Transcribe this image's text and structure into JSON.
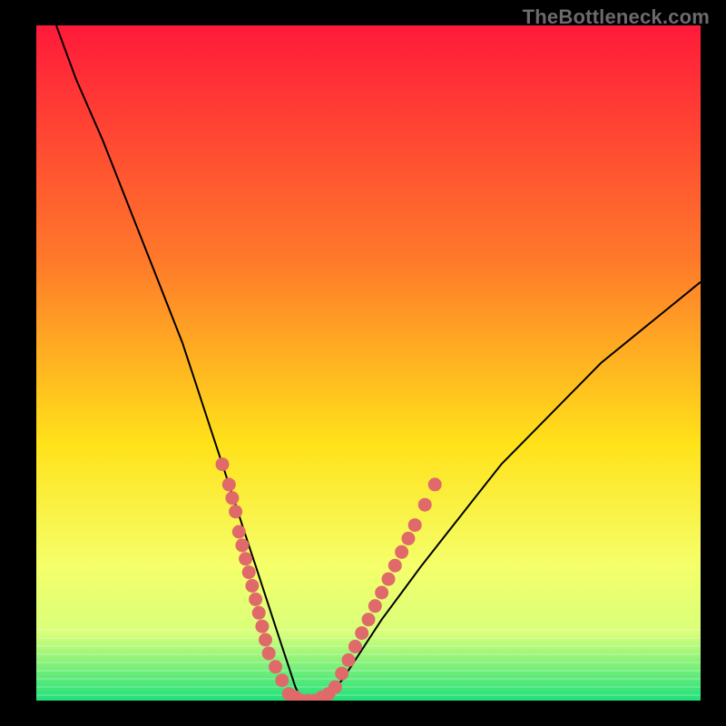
{
  "watermark": "TheBottleneck.com",
  "colors": {
    "frame": "#000000",
    "gradient_top": "#ff1a3a",
    "gradient_mid1": "#ff7a2a",
    "gradient_mid2": "#ffe21a",
    "gradient_low": "#f5ff6a",
    "gradient_band": "#d8ff7a",
    "gradient_bottom": "#1fe07a",
    "curve": "#000000",
    "dots": "#e06a6a"
  },
  "chart_data": {
    "type": "line",
    "title": "",
    "xlabel": "",
    "ylabel": "",
    "xlim": [
      0,
      100
    ],
    "ylim": [
      0,
      100
    ],
    "grid": false,
    "legend": false,
    "series": [
      {
        "name": "bottleneck-curve",
        "comment": "V-shaped bottleneck curve; y is approximate percentage bottleneck read from vertical position (0 = bottom/green, 100 = top/red).",
        "x": [
          3,
          6,
          10,
          14,
          18,
          22,
          24,
          26,
          28,
          30,
          31,
          32,
          33,
          34,
          35,
          36,
          37,
          38,
          39,
          40,
          41,
          42,
          43,
          44,
          46,
          48,
          50,
          52,
          55,
          58,
          62,
          66,
          70,
          75,
          80,
          85,
          90,
          95,
          100
        ],
        "y": [
          100,
          92,
          83,
          73,
          63,
          53,
          47,
          41,
          35,
          29,
          26,
          23,
          20,
          17,
          14,
          11,
          8,
          5,
          2,
          0,
          0,
          0,
          0,
          1,
          3,
          6,
          9,
          12,
          16,
          20,
          25,
          30,
          35,
          40,
          45,
          50,
          54,
          58,
          62
        ]
      }
    ],
    "annotations": {
      "valley_floor_x_range": [
        39,
        44
      ],
      "valley_floor_y": 0
    },
    "dot_clusters": {
      "comment": "Pink data markers clustered on both arms near the valley; y estimated relative to ylim.",
      "left_arm": [
        {
          "x": 28,
          "y": 35
        },
        {
          "x": 29,
          "y": 32
        },
        {
          "x": 29.5,
          "y": 30
        },
        {
          "x": 30,
          "y": 28
        },
        {
          "x": 30.5,
          "y": 25
        },
        {
          "x": 31,
          "y": 23
        },
        {
          "x": 31.5,
          "y": 21
        },
        {
          "x": 32,
          "y": 19
        },
        {
          "x": 32.5,
          "y": 17
        },
        {
          "x": 33,
          "y": 15
        },
        {
          "x": 33.5,
          "y": 13
        },
        {
          "x": 34,
          "y": 11
        },
        {
          "x": 34.5,
          "y": 9
        },
        {
          "x": 35,
          "y": 7
        },
        {
          "x": 36,
          "y": 5
        },
        {
          "x": 37,
          "y": 3
        }
      ],
      "valley": [
        {
          "x": 38,
          "y": 1
        },
        {
          "x": 39,
          "y": 0.5
        },
        {
          "x": 40,
          "y": 0
        },
        {
          "x": 41,
          "y": 0
        },
        {
          "x": 42,
          "y": 0
        },
        {
          "x": 43,
          "y": 0.5
        },
        {
          "x": 44,
          "y": 1
        }
      ],
      "right_arm": [
        {
          "x": 45,
          "y": 2
        },
        {
          "x": 46,
          "y": 4
        },
        {
          "x": 47,
          "y": 6
        },
        {
          "x": 48,
          "y": 8
        },
        {
          "x": 49,
          "y": 10
        },
        {
          "x": 50,
          "y": 12
        },
        {
          "x": 51,
          "y": 14
        },
        {
          "x": 52,
          "y": 16
        },
        {
          "x": 53,
          "y": 18
        },
        {
          "x": 54,
          "y": 20
        },
        {
          "x": 55,
          "y": 22
        },
        {
          "x": 56,
          "y": 24
        },
        {
          "x": 57,
          "y": 26
        },
        {
          "x": 58.5,
          "y": 29
        },
        {
          "x": 60,
          "y": 32
        }
      ]
    }
  }
}
